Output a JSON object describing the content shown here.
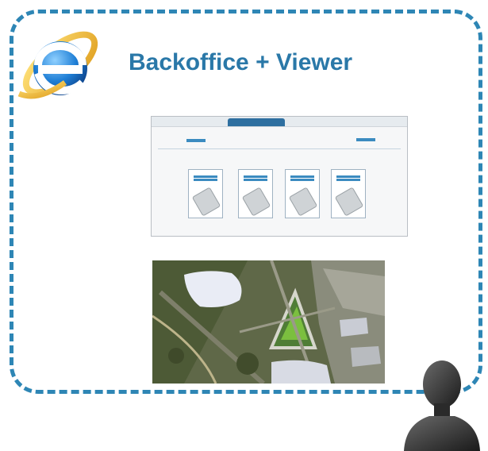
{
  "title": "Backoffice + Viewer",
  "icons": {
    "browser": "internet-explorer-icon",
    "user": "user-silhouette-icon"
  },
  "colors": {
    "accent": "#2e86b5",
    "title": "#2a78a8"
  },
  "backoffice_screen": {
    "cards": [
      {
        "name": "device-card-1"
      },
      {
        "name": "device-card-2"
      },
      {
        "name": "device-card-3"
      },
      {
        "name": "device-card-4"
      }
    ]
  },
  "viewer": {
    "image": "aerial-map-image"
  }
}
